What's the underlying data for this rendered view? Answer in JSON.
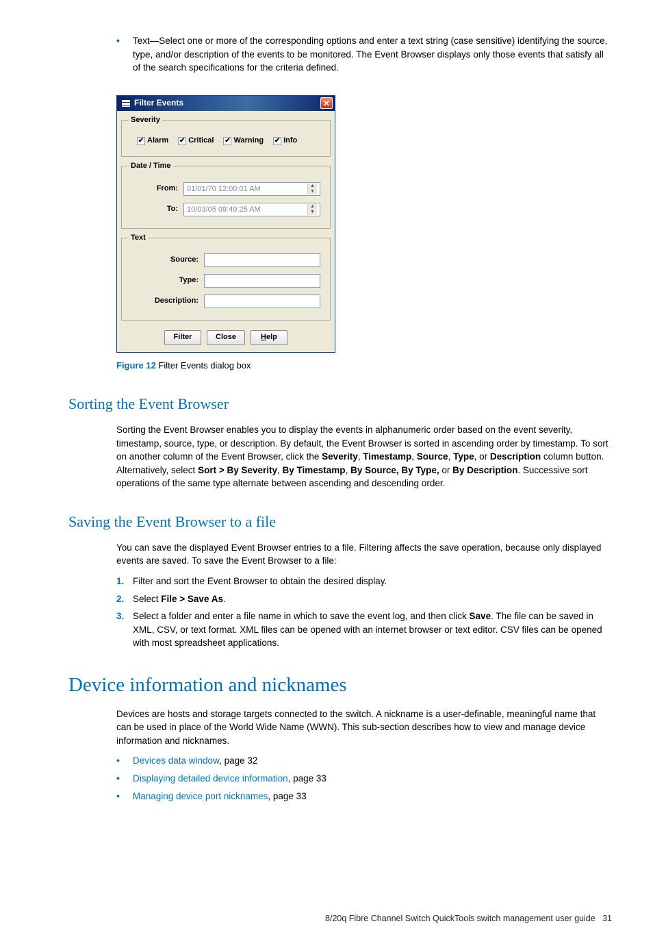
{
  "intro_bullet": {
    "prefix": "Text—",
    "body": "Select one or more of the corresponding options and enter a text string (case sensitive) identifying the source, type, and/or description of the events to be monitored. The Event Browser displays only those events that satisfy all of the search specifications for the criteria defined."
  },
  "dialog": {
    "title": "Filter Events",
    "close_glyph": "✕",
    "severity": {
      "legend": "Severity",
      "alarm": "Alarm",
      "critical": "Critical",
      "warning": "Warning",
      "info": "Info",
      "check": "✔"
    },
    "datetime": {
      "legend": "Date / Time",
      "from_label": "From:",
      "from_value": "01/01/70 12:00:01 AM",
      "to_label": "To:",
      "to_value": "10/03/05 09:49:25 AM"
    },
    "text": {
      "legend": "Text",
      "source_label": "Source:",
      "type_label": "Type:",
      "description_label": "Description:"
    },
    "buttons": {
      "filter": "Filter",
      "close": "Close",
      "help_prefix": "H",
      "help_rest": "elp"
    }
  },
  "figure": {
    "label": "Figure 12",
    "caption": " Filter Events dialog box"
  },
  "sorting": {
    "heading": "Sorting the Event Browser",
    "p1_a": "Sorting the Event Browser enables you to display the events in alphanumeric order based on the event severity, timestamp, source, type, or description. By default, the Event Browser is sorted in ascending order by timestamp. To sort on another column of the Event Browser, click the ",
    "b1": "Severity",
    "c1": ", ",
    "b2": "Timestamp",
    "c2": ", ",
    "b3": "Source",
    "c3": ", ",
    "b4": "Type",
    "c4": ", or ",
    "b5": "Description",
    "p1_b": " column button. Alternatively, select ",
    "b6": "Sort > By Severity",
    "c5": ", ",
    "b7": "By Timestamp",
    "c6": ", ",
    "b8": "By Source, By Type,",
    "c7": " or ",
    "b9": "By Description",
    "p1_c": ". Successive sort operations of the same type alternate between ascending and descending order."
  },
  "saving": {
    "heading": "Saving the Event Browser to a file",
    "p1": "You can save the displayed Event Browser entries to a file. Filtering affects the save operation, because only displayed events are saved. To save the Event Browser to a file:",
    "steps": [
      {
        "n": "1.",
        "text_a": "Filter and sort the Event Browser to obtain the desired display."
      },
      {
        "n": "2.",
        "text_a": "Select ",
        "b1": "File > Save As",
        "text_b": "."
      },
      {
        "n": "3.",
        "text_a": "Select a folder and enter a file name in which to save the event log, and then click ",
        "b1": "Save",
        "text_b": ". The file can be saved in XML, CSV, or text format. XML files can be opened with an internet browser or text editor. CSV files can be opened with most spreadsheet applications."
      }
    ]
  },
  "device": {
    "heading": "Device information and nicknames",
    "p1": "Devices are hosts and storage targets connected to the switch. A nickname is a user-definable, meaningful name that can be used in place of the World Wide Name (WWN). This sub-section describes how to view and manage device information and nicknames.",
    "links": [
      {
        "text": "Devices data window",
        "page": ", page 32"
      },
      {
        "text": "Displaying detailed device information",
        "page": ", page 33"
      },
      {
        "text": "Managing device port nicknames",
        "page": ", page 33"
      }
    ]
  },
  "footer": {
    "text": "8/20q Fibre Channel Switch QuickTools switch management user guide",
    "page": "31"
  }
}
